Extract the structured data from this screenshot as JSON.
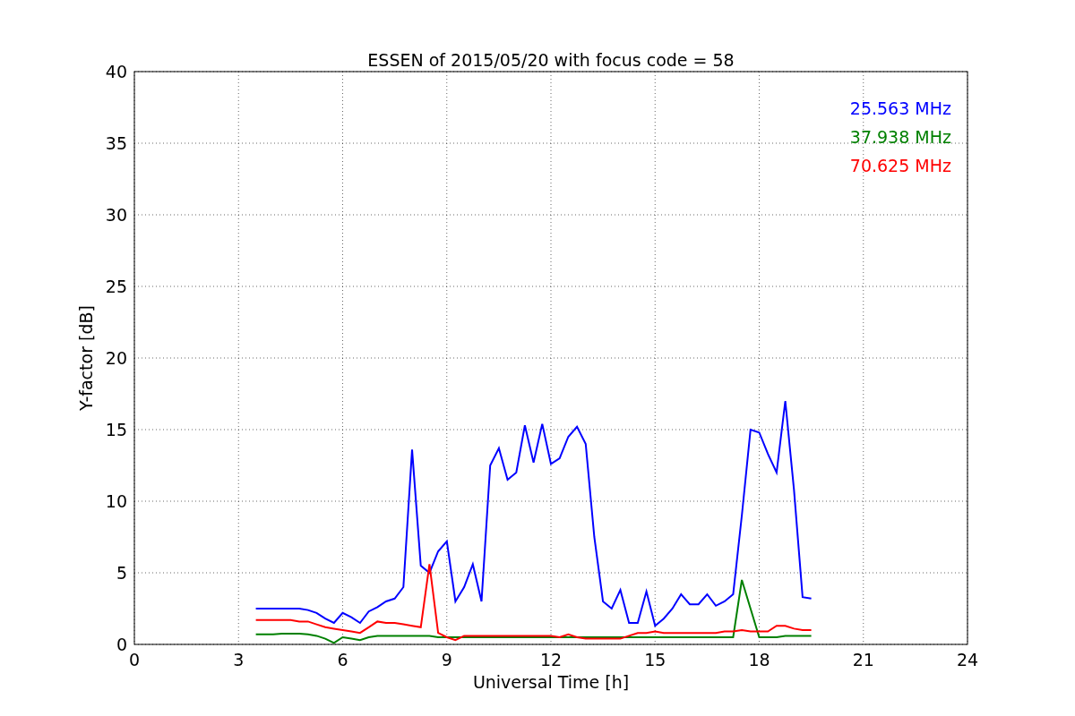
{
  "chart_data": {
    "type": "line",
    "title": "ESSEN of 2015/05/20 with focus code = 58",
    "xlabel": "Universal Time [h]",
    "ylabel": "Y-factor [dB]",
    "x": [
      3.5,
      3.75,
      4,
      4.25,
      4.5,
      4.75,
      5,
      5.25,
      5.5,
      5.75,
      6,
      6.25,
      6.5,
      6.75,
      7,
      7.25,
      7.5,
      7.75,
      8,
      8.25,
      8.5,
      8.75,
      9,
      9.25,
      9.5,
      9.75,
      10,
      10.25,
      10.5,
      10.75,
      11,
      11.25,
      11.5,
      11.75,
      12,
      12.25,
      12.5,
      12.75,
      13,
      13.25,
      13.5,
      13.75,
      14,
      14.25,
      14.5,
      14.75,
      15,
      15.25,
      15.5,
      15.75,
      16,
      16.25,
      16.5,
      16.75,
      17,
      17.25,
      17.5,
      17.75,
      18,
      18.25,
      18.5,
      18.75,
      19,
      19.25,
      19.5
    ],
    "series": [
      {
        "name": "25.563 MHz",
        "color": "#0000ff",
        "values": [
          2.5,
          2.5,
          2.5,
          2.5,
          2.5,
          2.5,
          2.4,
          2.2,
          1.8,
          1.5,
          2.2,
          1.9,
          1.5,
          2.3,
          2.6,
          3,
          3.2,
          4,
          13.6,
          5.5,
          5,
          6.5,
          7.2,
          3,
          4,
          5.6,
          3,
          12.5,
          13.7,
          11.5,
          12,
          15.3,
          12.7,
          15.4,
          12.6,
          13,
          14.5,
          15.2,
          14,
          7.5,
          3,
          2.5,
          3.8,
          1.5,
          1.5,
          3.7,
          1.3,
          1.8,
          2.5,
          3.5,
          2.8,
          2.8,
          3.5,
          2.7,
          3,
          3.5,
          9,
          15,
          14.8,
          13.3,
          12,
          17,
          10.8,
          3.3,
          3.2
        ]
      },
      {
        "name": "37.938 MHz",
        "color": "#008000",
        "values": [
          0.7,
          0.7,
          0.7,
          0.75,
          0.75,
          0.75,
          0.7,
          0.6,
          0.4,
          0.1,
          0.5,
          0.4,
          0.3,
          0.5,
          0.6,
          0.6,
          0.6,
          0.6,
          0.6,
          0.6,
          0.6,
          0.5,
          0.5,
          0.5,
          0.5,
          0.5,
          0.5,
          0.5,
          0.5,
          0.5,
          0.5,
          0.5,
          0.5,
          0.5,
          0.5,
          0.5,
          0.5,
          0.5,
          0.5,
          0.5,
          0.5,
          0.5,
          0.5,
          0.5,
          0.5,
          0.5,
          0.5,
          0.5,
          0.5,
          0.5,
          0.5,
          0.5,
          0.5,
          0.5,
          0.5,
          0.5,
          4.5,
          2.5,
          0.5,
          0.5,
          0.5,
          0.6,
          0.6,
          0.6,
          0.6
        ]
      },
      {
        "name": "70.625 MHz",
        "color": "#ff0000",
        "values": [
          1.7,
          1.7,
          1.7,
          1.7,
          1.7,
          1.6,
          1.6,
          1.4,
          1.2,
          1.1,
          1,
          0.9,
          0.8,
          1.2,
          1.6,
          1.5,
          1.5,
          1.4,
          1.3,
          1.2,
          5.6,
          0.8,
          0.5,
          0.3,
          0.6,
          0.6,
          0.6,
          0.6,
          0.6,
          0.6,
          0.6,
          0.6,
          0.6,
          0.6,
          0.6,
          0.5,
          0.7,
          0.5,
          0.4,
          0.4,
          0.4,
          0.4,
          0.4,
          0.6,
          0.8,
          0.8,
          0.9,
          0.8,
          0.8,
          0.8,
          0.8,
          0.8,
          0.8,
          0.8,
          0.9,
          0.9,
          1,
          0.9,
          0.9,
          0.9,
          1.3,
          1.3,
          1.1,
          1,
          1
        ]
      }
    ],
    "grid": true,
    "xlim": [
      0,
      24
    ],
    "ylim": [
      0,
      40
    ],
    "xticks": [
      0,
      3,
      6,
      9,
      12,
      15,
      18,
      21,
      24
    ],
    "yticks": [
      0,
      5,
      10,
      15,
      20,
      25,
      30,
      35,
      40
    ]
  }
}
